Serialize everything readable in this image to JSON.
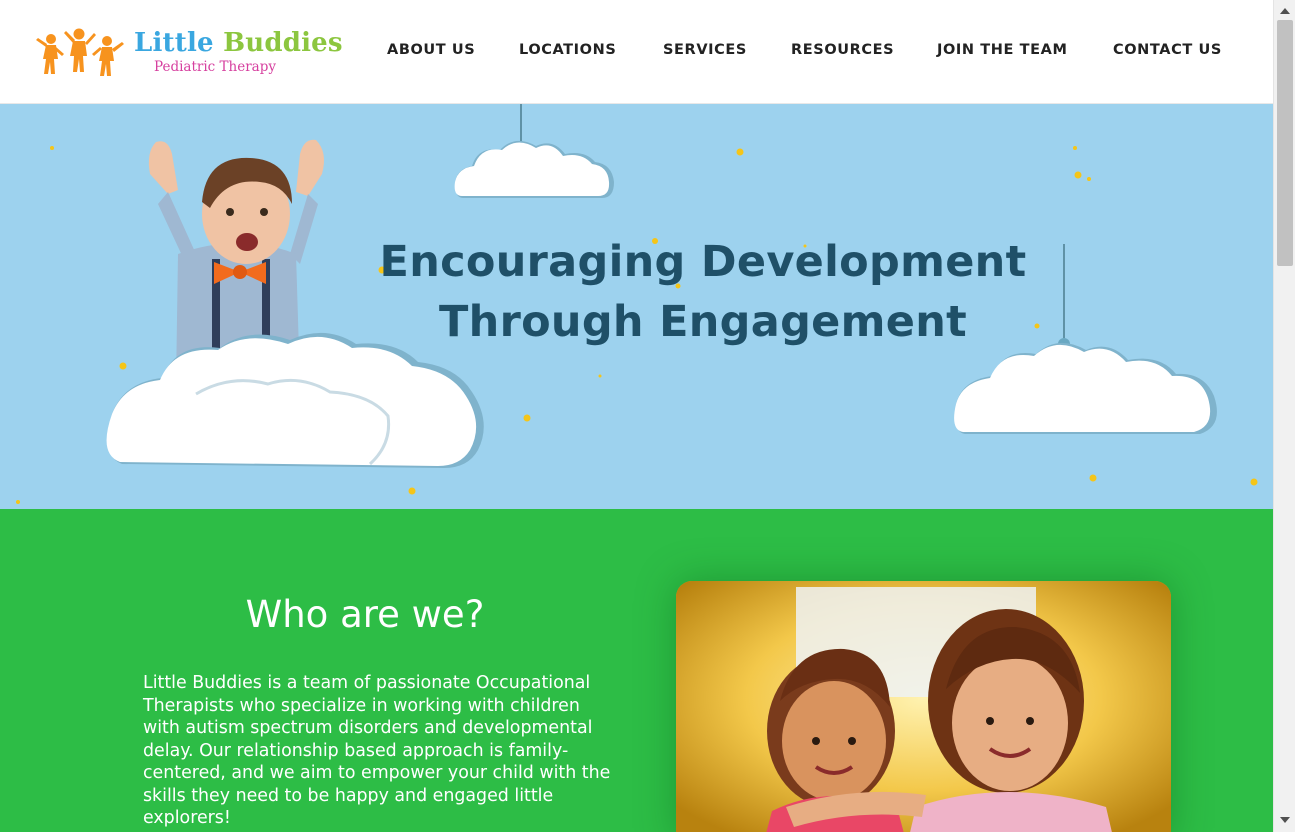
{
  "logo": {
    "name_part1": "Little",
    "name_part2": "Buddies",
    "tagline": "Pediatric Therapy",
    "colors": {
      "little": "#3aa7e0",
      "buddies": "#8cc63f",
      "tagline": "#d6409f",
      "figures": "#f7931e"
    }
  },
  "nav": {
    "items": [
      {
        "label": "ABOUT US"
      },
      {
        "label": "LOCATIONS"
      },
      {
        "label": "SERVICES"
      },
      {
        "label": "RESOURCES"
      },
      {
        "label": "JOIN THE TEAM"
      },
      {
        "label": "CONTACT US"
      }
    ]
  },
  "hero": {
    "title_line1": "Encouraging Development",
    "title_line2": "Through Engagement",
    "background": "#9dd2ee",
    "title_color": "#1f5068"
  },
  "about": {
    "heading": "Who are we?",
    "body": "Little Buddies is a team of passionate Occupational Therapists who specialize in working with children with autism spectrum disorders and developmental delay. Our relationship based approach is family-centered, and we aim to empower your child with the skills they need to be happy and engaged little explorers!",
    "background": "#2dbd46"
  },
  "icons": {
    "logo_figures": "dancing-children-icon",
    "scroll_up": "chevron-up-icon",
    "scroll_down": "chevron-down-icon"
  }
}
